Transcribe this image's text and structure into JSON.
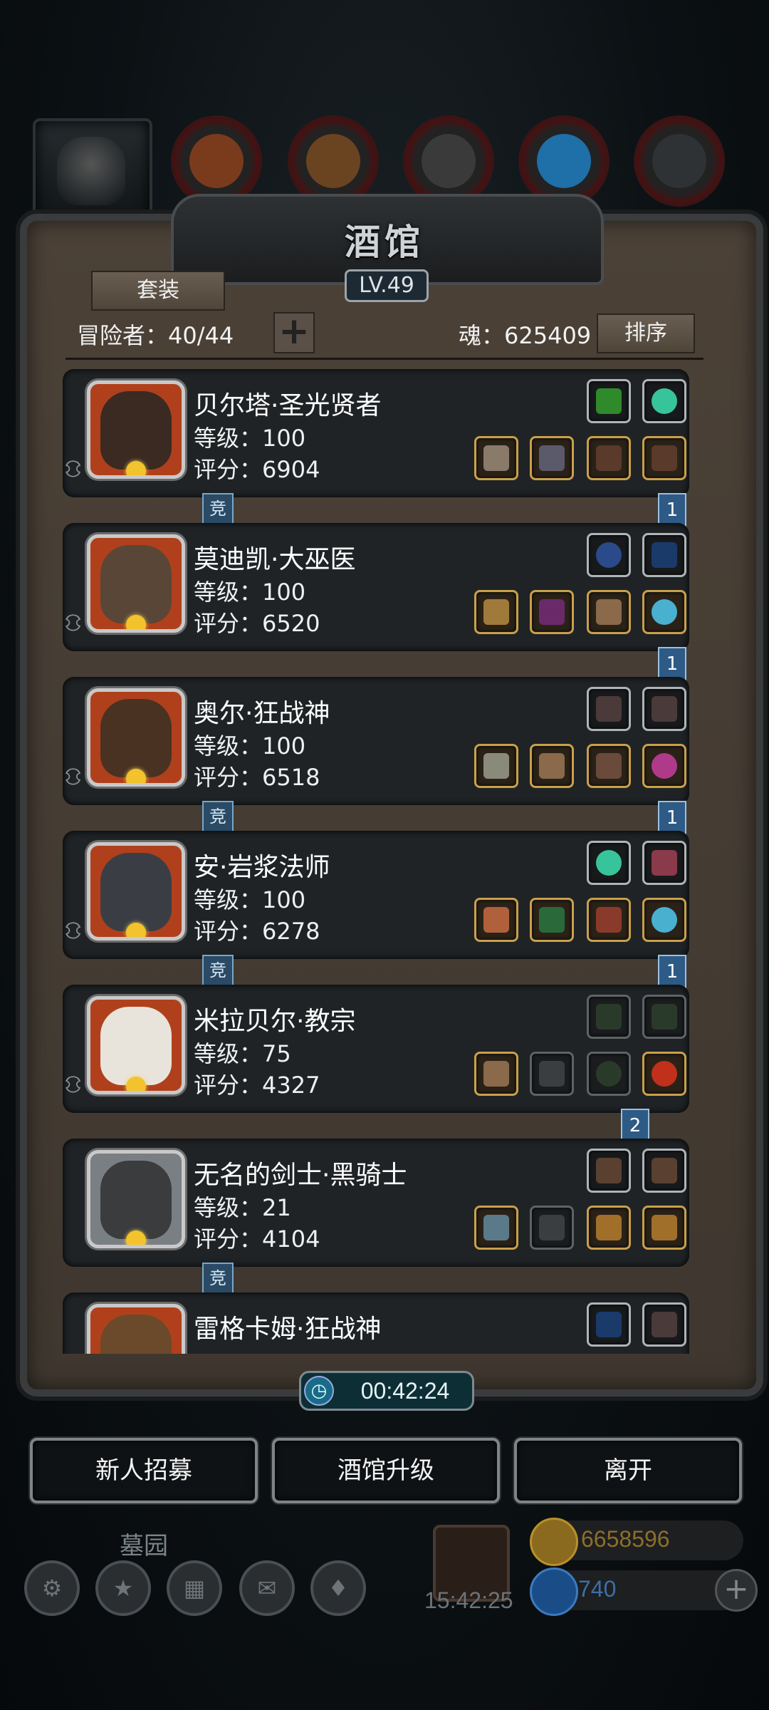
{
  "header": {
    "title": "酒馆",
    "level": "LV.49",
    "resource_counts": [
      "",
      "",
      "",
      "",
      "",
      ""
    ]
  },
  "toolbar": {
    "suit_label": "套装",
    "adventurers_label": "冒险者：40/44",
    "add_label": "+",
    "soul_label": "魂：625409",
    "sort_label": "排序"
  },
  "heroes": [
    {
      "name": "贝尔塔·圣光贤者",
      "level": "等级：100",
      "score": "评分：6904",
      "tag_jing": "竞",
      "tag_num": "1"
    },
    {
      "name": "莫迪凯·大巫医",
      "level": "等级：100",
      "score": "评分：6520",
      "tag_jing": "",
      "tag_num": "1"
    },
    {
      "name": "奥尔·狂战神",
      "level": "等级：100",
      "score": "评分：6518",
      "tag_jing": "竞",
      "tag_num": "1"
    },
    {
      "name": "安·岩浆法师",
      "level": "等级：100",
      "score": "评分：6278",
      "tag_jing": "竞",
      "tag_num": "1"
    },
    {
      "name": "米拉贝尔·教宗",
      "level": "等级：75",
      "score": "评分：4327",
      "tag_jing": "",
      "tag_num": "2"
    },
    {
      "name": "无名的剑士·黑骑士",
      "level": "等级：21",
      "score": "评分：4104",
      "tag_jing": "竞",
      "tag_num": ""
    },
    {
      "name": "雷格卡姆·狂战神",
      "level": "",
      "score": "",
      "tag_jing": "",
      "tag_num": ""
    }
  ],
  "timer": "00:42:24",
  "actions": {
    "recruit": "新人招募",
    "upgrade": "酒馆升级",
    "leave": "离开"
  },
  "background": {
    "graveyard": "墓园",
    "gift_time": "15:42:25",
    "gold": "6658596",
    "gems": "740",
    "add": "+"
  },
  "colors": {
    "panel": "#4b4137",
    "card": "#1f2326",
    "avatar_bg": "#b0401c",
    "gold_border": "#c9a04a",
    "tag_blue": "#2e5a86"
  }
}
